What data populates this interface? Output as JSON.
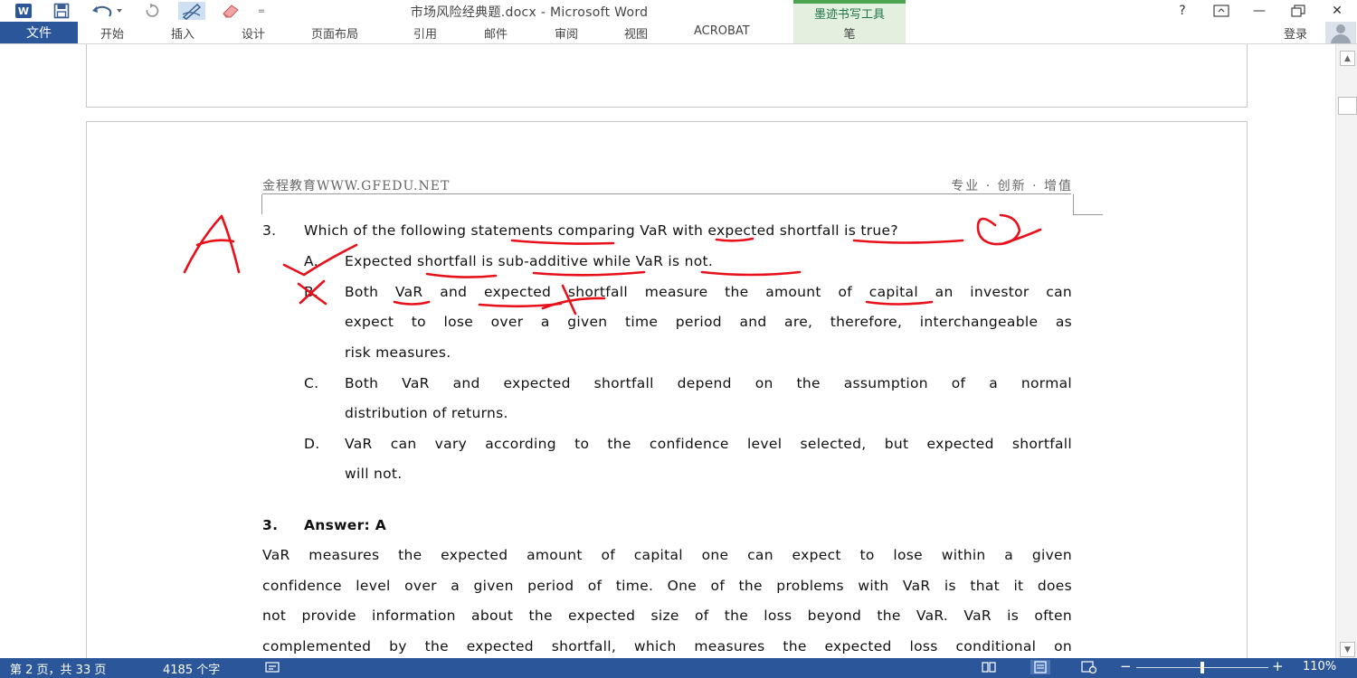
{
  "app": {
    "doc_title": "市场风险经典题.docx - Microsoft Word",
    "ink_tools_label": "墨迹书写工具",
    "word_logo": "W"
  },
  "quick_access": {
    "more": "="
  },
  "window_controls": {
    "help": "?",
    "minimize": "—",
    "close": "✕"
  },
  "ribbon": {
    "file": "文件",
    "tabs": [
      "开始",
      "插入",
      "设计",
      "页面布局",
      "引用",
      "邮件",
      "审阅",
      "视图",
      "ACROBAT"
    ],
    "ink_tab": "笔",
    "signin": "登录"
  },
  "page": {
    "header_left": "金程教育WWW.GFEDU.NET",
    "header_right": "专业 · 创新 · 增值",
    "question": {
      "number": "3.",
      "text": "Which of the following statements comparing VaR with expected shortfall is true?",
      "options": [
        {
          "letter": "A.",
          "lines": [
            "Expected shortfall is sub-additive while VaR is not."
          ]
        },
        {
          "letter": "B.",
          "lines": [
            "Both VaR and expected shortfall measure the amount of capital an investor can",
            "expect to lose over a given time period and are, therefore, interchangeable as",
            "risk measures."
          ]
        },
        {
          "letter": "C.",
          "lines": [
            "Both VaR and expected shortfall depend on the assumption of a normal",
            "distribution of returns."
          ]
        },
        {
          "letter": "D.",
          "lines": [
            "VaR can vary according to the confidence level selected, but expected shortfall",
            "will not."
          ]
        }
      ]
    },
    "answer": {
      "number": "3.",
      "label": "Answer: A",
      "lines": [
        "VaR measures the expected amount of capital one can expect to lose within a given",
        "confidence level over a given period of time. One of the problems with VaR is that it does",
        "not provide information about the expected size of the loss beyond the VaR. VaR is often",
        "complemented by the expected shortfall, which measures the expected loss conditional on"
      ]
    }
  },
  "status": {
    "page": "第 2 页，共 33 页",
    "words": "4185 个字",
    "zoom_minus": "−",
    "zoom_plus": "+",
    "zoom": "110%"
  }
}
